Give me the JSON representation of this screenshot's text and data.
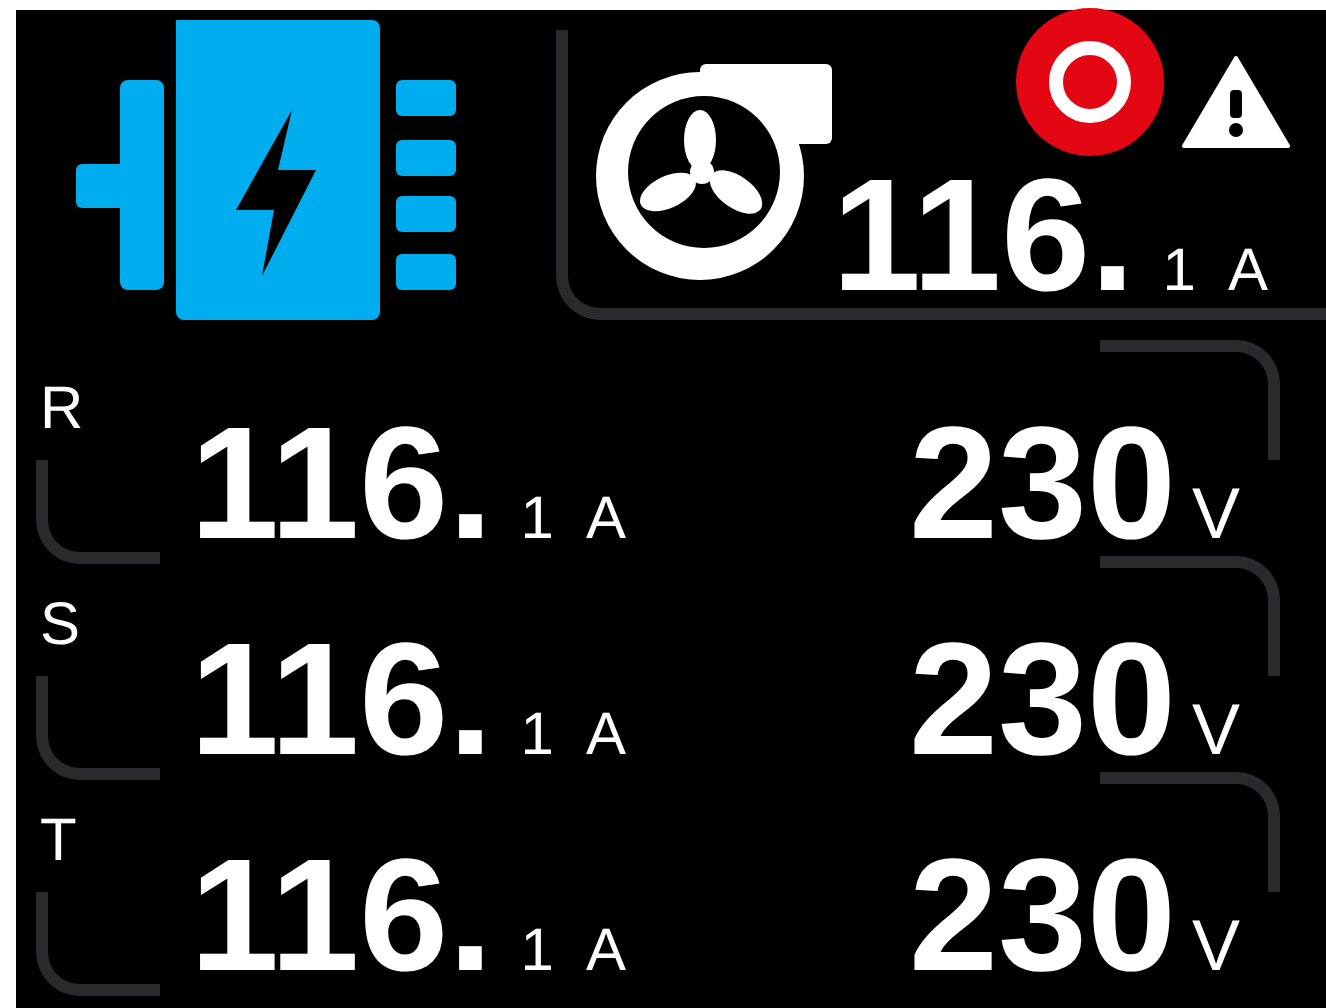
{
  "status": {
    "alarm": true,
    "warning": true
  },
  "fan": {
    "current_main": "116.",
    "current_decimal": "1",
    "current_unit": "A"
  },
  "phases": [
    {
      "label": "R",
      "current_main": "116.",
      "current_decimal": "1",
      "current_unit": "A",
      "voltage": "230",
      "voltage_unit": "V"
    },
    {
      "label": "S",
      "current_main": "116.",
      "current_decimal": "1",
      "current_unit": "A",
      "voltage": "230",
      "voltage_unit": "V"
    },
    {
      "label": "T",
      "current_main": "116.",
      "current_decimal": "1",
      "current_unit": "A",
      "voltage": "230",
      "voltage_unit": "V"
    }
  ]
}
